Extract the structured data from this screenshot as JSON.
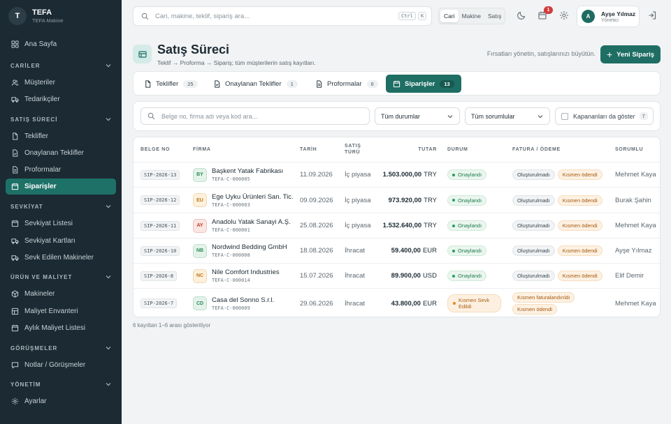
{
  "app": {
    "name": "TEFA",
    "subtitle": "TEFA Makine",
    "logo_letter": "T"
  },
  "sidebar": {
    "home": "Ana Sayfa",
    "sections": [
      {
        "title": "CARİLER",
        "items": [
          "Müşteriler",
          "Tedarikçiler"
        ]
      },
      {
        "title": "SATIŞ SÜRECİ",
        "items": [
          "Teklifler",
          "Onaylanan Teklifler",
          "Proformalar",
          "Siparişler"
        ]
      },
      {
        "title": "SEVKİYAT",
        "items": [
          "Sevkiyat Listesi",
          "Sevkiyat Kartları",
          "Sevk Edilen Makineler"
        ]
      },
      {
        "title": "ÜRÜN VE MALİYET",
        "items": [
          "Makineler",
          "Maliyet Envanteri",
          "Aylık Maliyet Listesi"
        ]
      },
      {
        "title": "GÖRÜŞMELER",
        "items": [
          "Notlar / Görüşmeler"
        ]
      },
      {
        "title": "YÖNETİM",
        "items": [
          "Ayarlar"
        ]
      }
    ],
    "active": "Siparişler"
  },
  "topbar": {
    "search_placeholder": "Cari, makine, teklif, sipariş ara...",
    "kbd_ctrl": "Ctrl",
    "kbd_k": "K",
    "scope": [
      "Cari",
      "Makine",
      "Satış"
    ],
    "scope_selected": "Cari",
    "notifications": "1",
    "user_name": "Ayşe Yılmaz",
    "user_role": "Yönetici",
    "user_initial": "A"
  },
  "header": {
    "title": "Satış Süreci",
    "subtitle": "Teklif → Proforma → Sipariş; tüm müşterilerin satış kayıtları.",
    "hint": "Fırsatları yönetin, satışlarınızı büyütün.",
    "new_button": "Yeni Sipariş"
  },
  "tabs": [
    {
      "label": "Teklifler",
      "count": "25"
    },
    {
      "label": "Onaylanan Teklifler",
      "count": "1"
    },
    {
      "label": "Proformalar",
      "count": "6"
    },
    {
      "label": "Siparişler",
      "count": "13"
    }
  ],
  "filters": {
    "search_placeholder": "Belge no, firma adı veya kod ara...",
    "status": "Tüm durumlar",
    "owner": "Tüm sorumlular",
    "show_closed": "Kapananları da göster",
    "closed_count": "7"
  },
  "table": {
    "headers": {
      "doc": "BELGE NO",
      "firm": "FİRMA",
      "date": "TARİH",
      "type": "SATIŞ TÜRÜ",
      "total": "TUTAR",
      "status": "DURUM",
      "invoice": "FATURA / ÖDEME",
      "owner": "SORUMLU"
    },
    "rows": [
      {
        "doc": "SIP-2026-13",
        "initials": "BY",
        "ini_color": "#2f8a5c",
        "ini_bg": "#e3f3ea",
        "firm": "Başkent Yatak Fabrikası",
        "code": "TEFA-C-000005",
        "date": "11.09.2026",
        "type": "İç piyasa",
        "amount": "1.503.000,00",
        "currency": "TRY",
        "status": "Onaylandı",
        "status_kind": "green",
        "invoice": "Oluşturulmadı",
        "payment": "Kısmen ödendi",
        "owner": "Mehmet Kaya"
      },
      {
        "doc": "SIP-2026-12",
        "initials": "EU",
        "ini_color": "#b7791f",
        "ini_bg": "#fdf1dc",
        "firm": "Ege Uyku Ürünleri San. Tic.",
        "code": "TEFA-C-000003",
        "date": "09.09.2026",
        "type": "İç piyasa",
        "amount": "973.920,00",
        "currency": "TRY",
        "status": "Onaylandı",
        "status_kind": "green",
        "invoice": "Oluşturulmadı",
        "payment": "Kısmen ödendi",
        "owner": "Burak Şahin"
      },
      {
        "doc": "SIP-2026-11",
        "initials": "AY",
        "ini_color": "#c0392b",
        "ini_bg": "#fbe6e4",
        "firm": "Anadolu Yatak Sanayi A.Ş.",
        "code": "TEFA-C-000001",
        "date": "25.08.2026",
        "type": "İç piyasa",
        "amount": "1.532.640,00",
        "currency": "TRY",
        "status": "Onaylandı",
        "status_kind": "green",
        "invoice": "Oluşturulmadı",
        "payment": "Kısmen ödendi",
        "owner": "Mehmet Kaya"
      },
      {
        "doc": "SIP-2026-10",
        "initials": "NB",
        "ini_color": "#2f8a5c",
        "ini_bg": "#e3f3ea",
        "firm": "Nordwind Bedding GmbH",
        "code": "TEFA-C-000008",
        "date": "18.08.2026",
        "type": "İhracat",
        "amount": "59.400,00",
        "currency": "EUR",
        "status": "Onaylandı",
        "status_kind": "green",
        "invoice": "Oluşturulmadı",
        "payment": "Kısmen ödendi",
        "owner": "Ayşe Yılmaz"
      },
      {
        "doc": "SIP-2026-8",
        "initials": "NC",
        "ini_color": "#b7791f",
        "ini_bg": "#fdf1dc",
        "firm": "Nile Comfort Industries",
        "code": "TEFA-C-000014",
        "date": "15.07.2026",
        "type": "İhracat",
        "amount": "89.900,00",
        "currency": "USD",
        "status": "Onaylandı",
        "status_kind": "green",
        "invoice": "Oluşturulmadı",
        "payment": "Kısmen ödendi",
        "owner": "Elif Demir"
      },
      {
        "doc": "SIP-2026-7",
        "initials": "CD",
        "ini_color": "#2f8a5c",
        "ini_bg": "#e3f3ea",
        "firm": "Casa del Sonno S.r.l.",
        "code": "TEFA-C-000009",
        "date": "29.06.2026",
        "type": "İhracat",
        "amount": "43.800,00",
        "currency": "EUR",
        "status": "Kısmen Sevk Edildi",
        "status_kind": "orange",
        "invoice": "Kısmen faturalandırıldı",
        "payment": "Kısmen ödendi",
        "owner": "Mehmet Kaya"
      }
    ]
  },
  "footer": "6 kayıttan 1–6 arası gösteriliyor",
  "colors": {
    "sidebar_bg": "#1b2a33",
    "accent": "#1e6e64",
    "active_nav": "#1e7167"
  }
}
